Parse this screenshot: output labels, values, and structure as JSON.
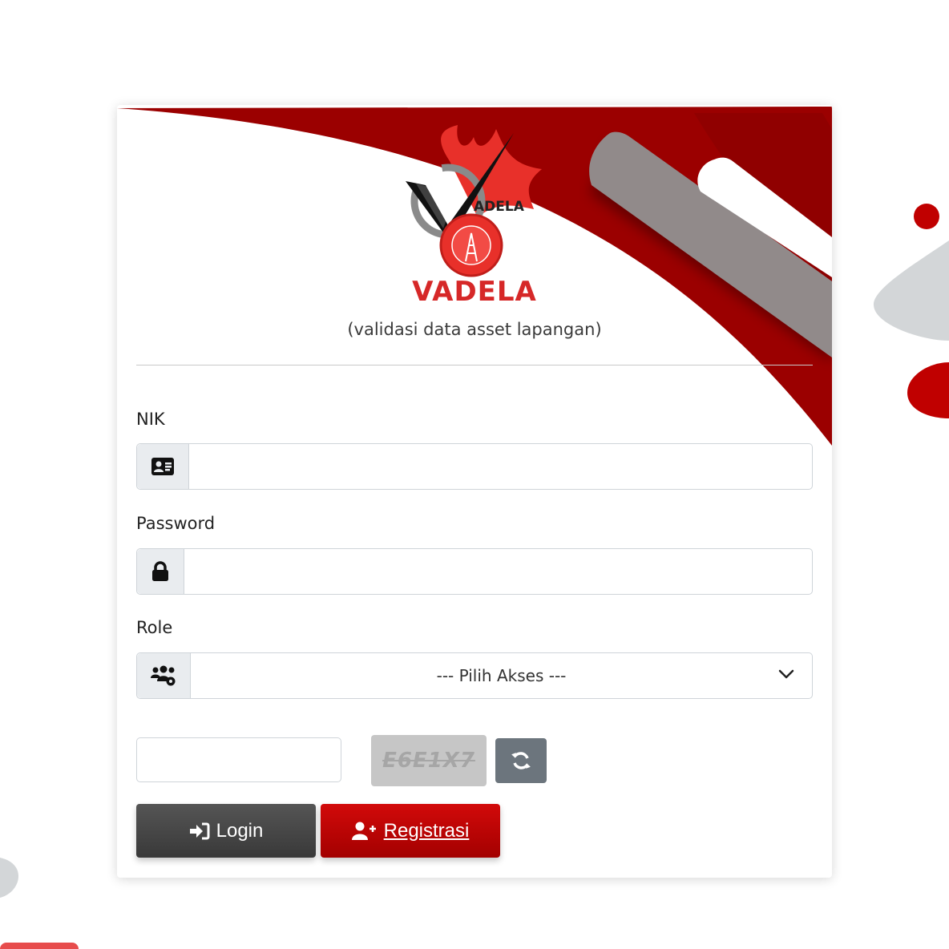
{
  "brand": {
    "logo_text": "ADELA",
    "logo_ring_text": "Validasi Data Asset Lapangan",
    "name": "VADELA",
    "subtitle": "(validasi data asset lapangan)"
  },
  "form": {
    "nik": {
      "label": "NIK",
      "value": "",
      "icon": "id-card-icon"
    },
    "password": {
      "label": "Password",
      "value": "",
      "icon": "lock-icon"
    },
    "role": {
      "label": "Role",
      "selected": "--- Pilih Akses ---",
      "icon": "users-gear-icon"
    },
    "captcha": {
      "value": "",
      "image_text": "E6E1X7",
      "refresh_icon": "refresh-icon"
    }
  },
  "buttons": {
    "login_label": "Login",
    "login_icon": "sign-in-icon",
    "register_label": "Registrasi",
    "register_icon": "user-plus-icon"
  },
  "colors": {
    "brand_red": "#d62828",
    "dark_red": "#9b0000",
    "login_button": "#454545",
    "register_button": "#c00000",
    "refresh_button": "#6c757d",
    "addon_bg": "#e9ecef"
  }
}
